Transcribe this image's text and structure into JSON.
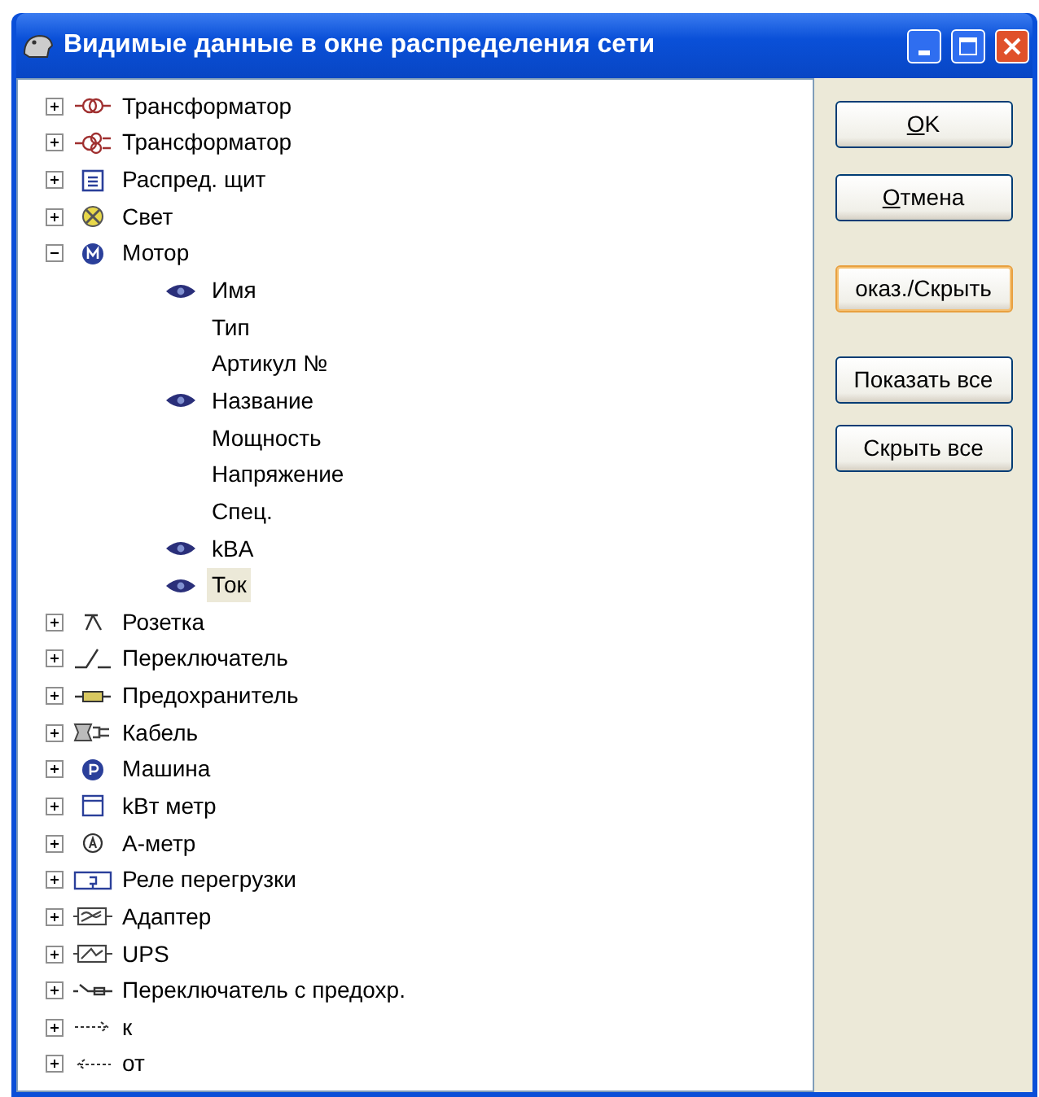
{
  "window": {
    "title": "Видимые данные в окне распределения сети"
  },
  "tree": [
    {
      "label": "Трансформатор",
      "kind": "transformer",
      "expanded": false
    },
    {
      "label": "Трансформатор",
      "kind": "transformer3",
      "expanded": false
    },
    {
      "label": "Распред. щит",
      "kind": "panel",
      "expanded": false
    },
    {
      "label": "Свет",
      "kind": "light",
      "expanded": false
    },
    {
      "label": "Мотор",
      "kind": "motor",
      "expanded": true,
      "children": [
        {
          "label": "Имя",
          "visible": true,
          "selected": false
        },
        {
          "label": "Тип",
          "visible": false,
          "selected": false
        },
        {
          "label": "Артикул №",
          "visible": false,
          "selected": false
        },
        {
          "label": "Название",
          "visible": true,
          "selected": false
        },
        {
          "label": "Мощность",
          "visible": false,
          "selected": false
        },
        {
          "label": "Напряжение",
          "visible": false,
          "selected": false
        },
        {
          "label": "Спец.",
          "visible": false,
          "selected": false
        },
        {
          "label": "kBA",
          "visible": true,
          "selected": false
        },
        {
          "label": "Ток",
          "visible": true,
          "selected": true
        }
      ]
    },
    {
      "label": "Розетка",
      "kind": "socket",
      "expanded": false
    },
    {
      "label": "Переключатель",
      "kind": "switch",
      "expanded": false
    },
    {
      "label": "Предохранитель",
      "kind": "fuse",
      "expanded": false
    },
    {
      "label": "Кабель",
      "kind": "cable",
      "expanded": false
    },
    {
      "label": "Машина",
      "kind": "machine",
      "expanded": false
    },
    {
      "label": "kBт метр",
      "kind": "kwmeter",
      "expanded": false
    },
    {
      "label": "А-метр",
      "kind": "ameter",
      "expanded": false
    },
    {
      "label": "Реле перегрузки",
      "kind": "relay",
      "expanded": false
    },
    {
      "label": "Адаптер",
      "kind": "adapter",
      "expanded": false
    },
    {
      "label": "UPS",
      "kind": "ups",
      "expanded": false
    },
    {
      "label": "Переключатель с предохр.",
      "kind": "switchfuse",
      "expanded": false
    },
    {
      "label": "к",
      "kind": "arrow-to",
      "expanded": false
    },
    {
      "label": "от",
      "kind": "arrow-from",
      "expanded": false
    }
  ],
  "buttons": [
    {
      "label": "OK",
      "mnemonic": true,
      "focused": false
    },
    {
      "label": "Отмена",
      "mnemonic": true,
      "focused": false
    },
    {
      "label": "оказ./Скрыть",
      "mnemonic": false,
      "focused": true
    },
    {
      "label": "Показать все",
      "mnemonic": false,
      "focused": false
    },
    {
      "label": "Скрыть все",
      "mnemonic": false,
      "focused": false
    }
  ]
}
